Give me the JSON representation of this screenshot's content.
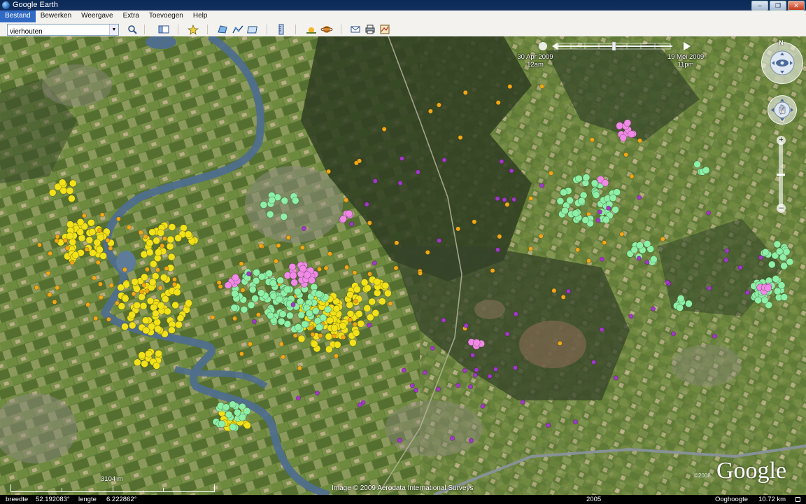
{
  "window": {
    "title": "Google Earth"
  },
  "menu": [
    "Bestand",
    "Bewerken",
    "Weergave",
    "Extra",
    "Toevoegen",
    "Help"
  ],
  "search": {
    "value": "vierhouten"
  },
  "time_slider": {
    "start_date": "30 Apr 2009",
    "start_time": "12am",
    "end_date": "19 Mei 2009",
    "end_time": "11pm"
  },
  "nav": {
    "north_label": "N"
  },
  "map": {
    "scale_label": "3104 m",
    "copyright": "Image © 2009 Aerodata International Surveys",
    "logo": "Google",
    "logo_year": "©2008"
  },
  "status": {
    "lat_label": "breedte",
    "lat_value": "52.192083°",
    "lon_label": "lengte",
    "lon_value": "6.222862°",
    "year": "2005",
    "eye_label": "Ooghoogte",
    "eye_value": "10.72 km"
  },
  "colors": {
    "yellow": "#f2e21a",
    "orange": "#f0a818",
    "green": "#8ef0a6",
    "purple": "#a238c8",
    "pink": "#f08ae6",
    "river": "#4f6e8c"
  },
  "icons": [
    "search-icon",
    "sidebar-icon",
    "placemark-icon",
    "polygon-icon",
    "path-icon",
    "overlay-icon",
    "ruler-icon",
    "sun-icon",
    "planets-icon",
    "email-icon",
    "print-icon",
    "maps-icon"
  ]
}
